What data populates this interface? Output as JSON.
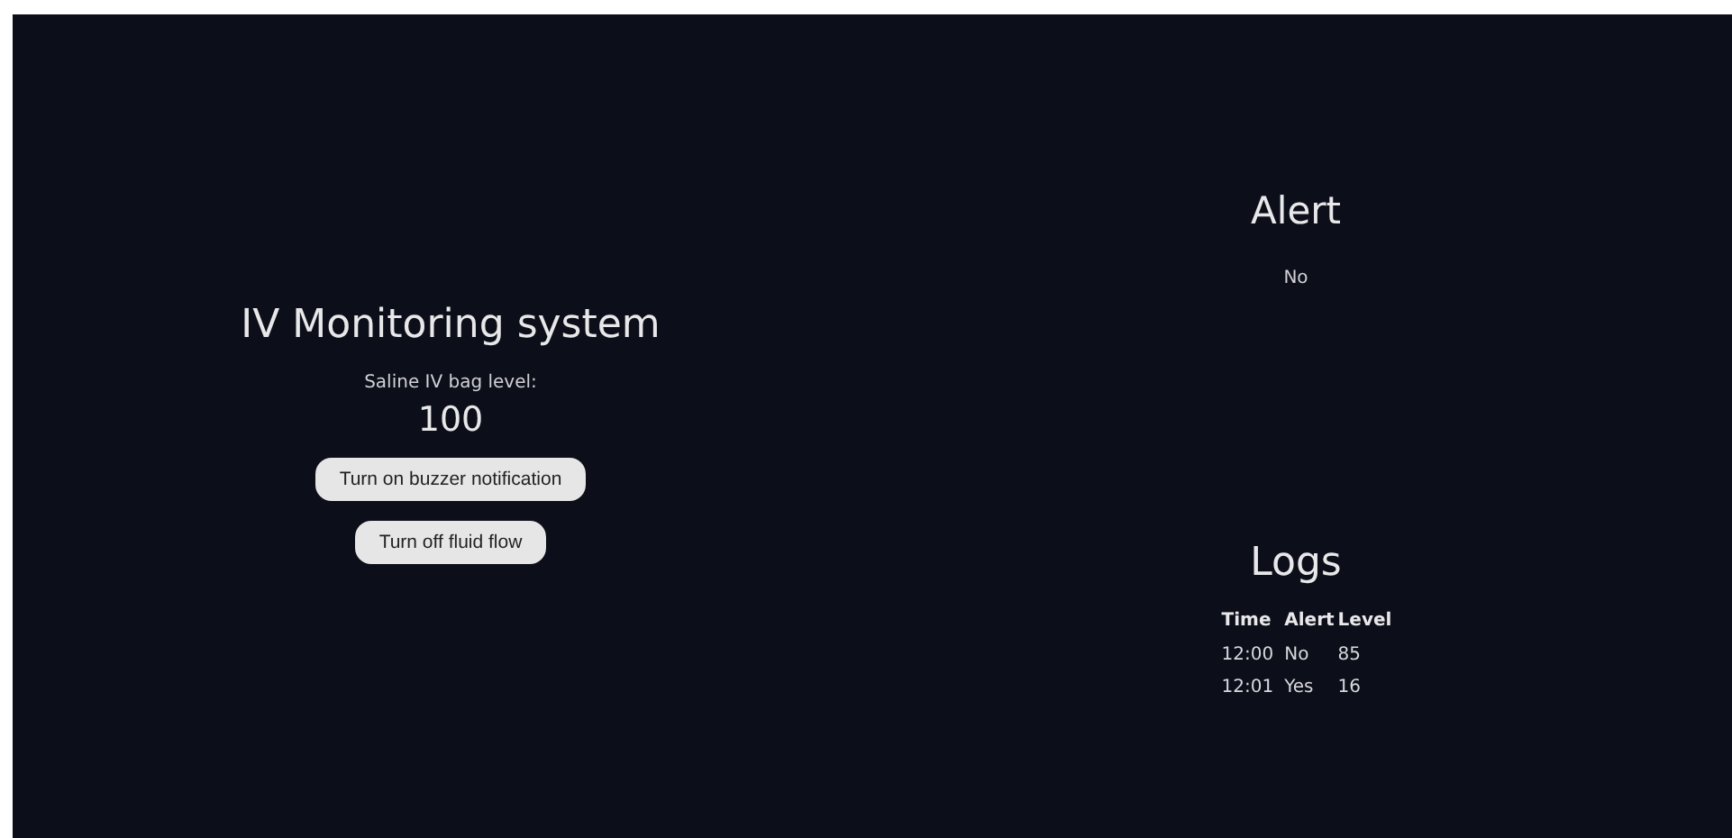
{
  "title": "IV Monitoring system",
  "level_label": "Saline IV bag level:",
  "level_value": "100",
  "buttons": [
    "Turn on buzzer notification",
    "Turn off fluid flow"
  ],
  "alert": {
    "heading": "Alert",
    "value": "No"
  },
  "logs": {
    "heading": "Logs",
    "columns": [
      "Time",
      "Alert",
      "Level"
    ],
    "rows": [
      [
        "12:00",
        "No",
        "85"
      ],
      [
        "12:01",
        "Yes",
        "16"
      ]
    ]
  }
}
